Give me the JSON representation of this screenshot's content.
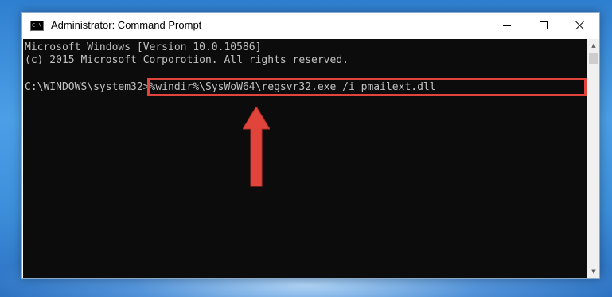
{
  "window": {
    "title": "Administrator: Command Prompt",
    "icon_label": "C:\\",
    "controls": {
      "minimize": "minimize-icon",
      "maximize": "maximize-icon",
      "close": "close-icon"
    }
  },
  "console": {
    "lines": [
      "Microsoft Windows [Version 10.0.10586]",
      "(c) 2015 Microsoft Corporotion. All rights reserved.",
      ""
    ],
    "prompt": "C:\\WINDOWS\\system32>",
    "command": "%windir%\\SysWoW64\\regsvr32.exe /i pmailext.dll"
  },
  "annotation": {
    "highlight_color": "#e0443a",
    "arrow_color": "#e0443a",
    "arrow_icon": "arrow-up-icon"
  },
  "scrollbar": {
    "up_icon": "scroll-up-icon",
    "down_icon": "scroll-down-icon"
  }
}
